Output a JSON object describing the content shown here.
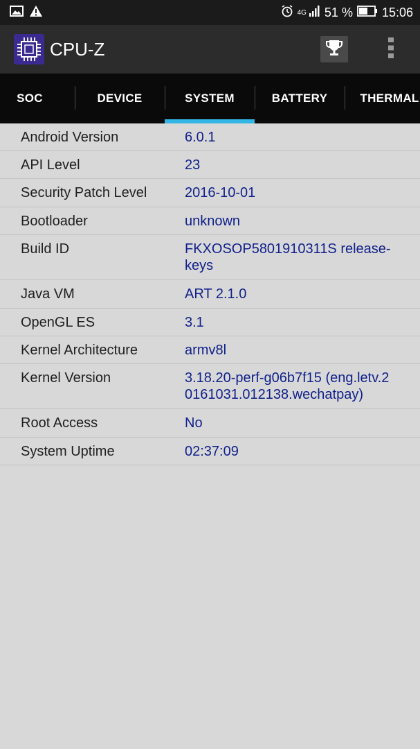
{
  "status_bar": {
    "network": "4G",
    "battery_percent": "51 %",
    "time": "15:06"
  },
  "app": {
    "title": "CPU-Z"
  },
  "tabs": [
    {
      "label": "SOC"
    },
    {
      "label": "DEVICE"
    },
    {
      "label": "SYSTEM",
      "active": true
    },
    {
      "label": "BATTERY"
    },
    {
      "label": "THERMAL"
    }
  ],
  "system_info": [
    {
      "label": "Android Version",
      "value": "6.0.1"
    },
    {
      "label": "API Level",
      "value": "23"
    },
    {
      "label": "Security Patch Level",
      "value": "2016-10-01"
    },
    {
      "label": "Bootloader",
      "value": "unknown"
    },
    {
      "label": "Build ID",
      "value": "FKXOSOP5801910311S release-keys"
    },
    {
      "label": "Java VM",
      "value": "ART 2.1.0"
    },
    {
      "label": "OpenGL ES",
      "value": "3.1"
    },
    {
      "label": "Kernel Architecture",
      "value": "armv8l"
    },
    {
      "label": "Kernel Version",
      "value": "3.18.20-perf-g06b7f15 (eng.letv.20161031.012138.wechatpay)"
    },
    {
      "label": "Root Access",
      "value": "No"
    },
    {
      "label": "System Uptime",
      "value": "02:37:09"
    }
  ],
  "colors": {
    "tab_indicator": "#33b5e5",
    "value_text": "#0f1f8a",
    "background": "#d8d8d8"
  }
}
